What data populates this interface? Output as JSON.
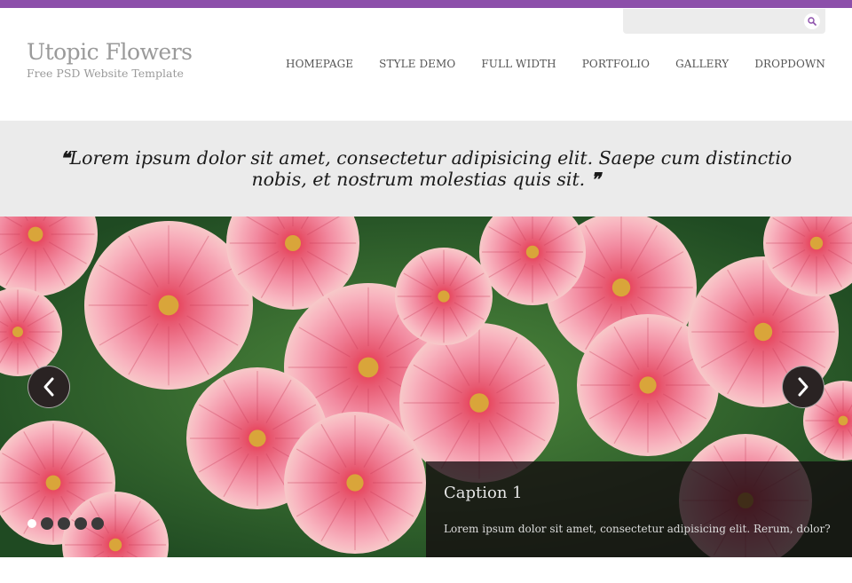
{
  "site": {
    "title": "Utopic Flowers",
    "subtitle": "Free PSD Website Template"
  },
  "search": {
    "placeholder": "",
    "icon": "search-icon"
  },
  "nav": {
    "items": [
      {
        "label": "HOMEPAGE"
      },
      {
        "label": "STYLE DEMO"
      },
      {
        "label": "FULL WIDTH"
      },
      {
        "label": "PORTFOLIO"
      },
      {
        "label": "GALLERY"
      },
      {
        "label": "DROPDOWN"
      }
    ]
  },
  "quote": {
    "open_mark": "❝",
    "text": "Lorem ipsum dolor sit amet, consectetur adipisicing elit. Saepe cum distinctio nobis, et nostrum molestias quis sit.",
    "close_mark": "❞"
  },
  "slider": {
    "prev_icon": "chevron-left-icon",
    "next_icon": "chevron-right-icon",
    "caption": {
      "title": "Caption 1",
      "text": "Lorem ipsum dolor sit amet, consectetur adipisicing elit. Rerum, dolor?"
    },
    "slide_count": 5,
    "active_slide": 1
  },
  "colors": {
    "accent": "#8c4faa",
    "band": "#ebebeb",
    "text_muted": "#9a9a9a"
  }
}
